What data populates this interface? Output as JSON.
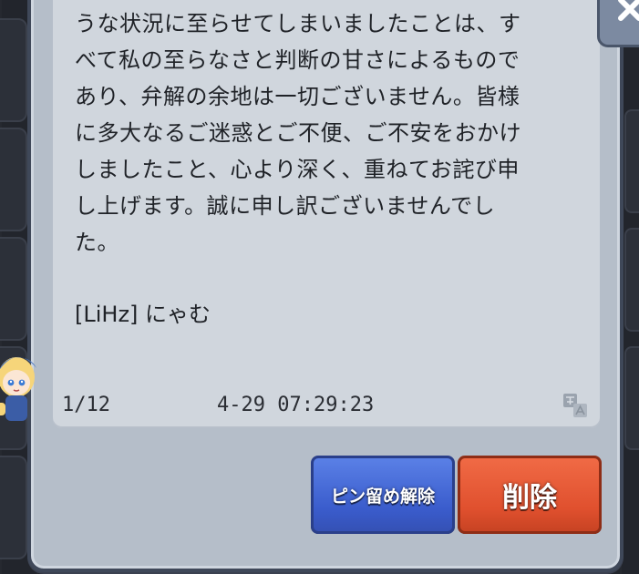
{
  "message": {
    "text": "うな状況に至らせてしまいましたことは、す\nべて私の至らなさと判断の甘さによるもので\nあり、弁解の余地は一切ございません。皆様\nに多大なるご迷惑とご不便、ご不安をおかけ\nしましたこと、心より深く、重ねてお詫び申\nし上げます。誠に申し訳ございませんでし\nた。",
    "signature": "[LiHz] にゃむ",
    "page_counter": "1/12",
    "timestamp": "4-29 07:29:23"
  },
  "buttons": {
    "unpin_label": "ピン留め解除",
    "delete_label": "削除"
  },
  "icons": {
    "close": "close-icon",
    "translate": "translate-icon",
    "avatar": "character-avatar"
  },
  "colors": {
    "unpin": "#3a5ccc",
    "delete": "#e0502e",
    "panel": "#d0d6dd"
  }
}
